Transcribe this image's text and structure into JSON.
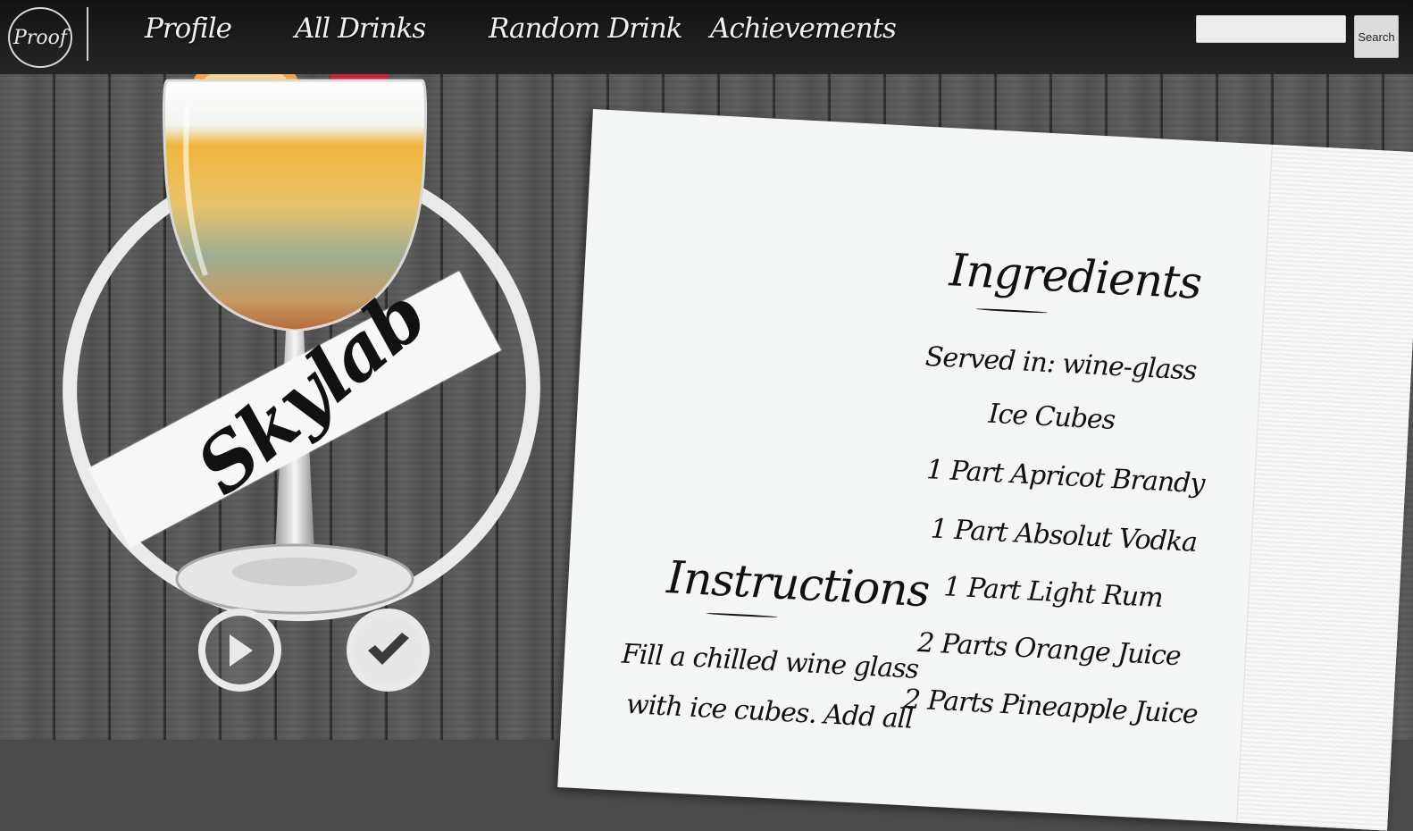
{
  "nav": {
    "logo_text": "Proof",
    "links": [
      "Profile",
      "All Drinks",
      "Random Drink",
      "Achievements"
    ],
    "search_placeholder": "",
    "search_button": "Search"
  },
  "drink": {
    "name": "Skylab",
    "play_icon": "play-icon",
    "check_icon": "check-icon"
  },
  "ingredients": {
    "heading": "Ingredients",
    "items": [
      "Served in: wine-glass",
      "Ice Cubes",
      "1 Part Apricot Brandy",
      "1 Part Absolut Vodka",
      "1 Part Light Rum",
      "2 Parts Orange Juice",
      "2 Parts Pineapple Juice"
    ]
  },
  "instructions": {
    "heading": "Instructions",
    "lines": [
      "Fill a chilled wine glass",
      "with ice cubes. Add all"
    ]
  }
}
